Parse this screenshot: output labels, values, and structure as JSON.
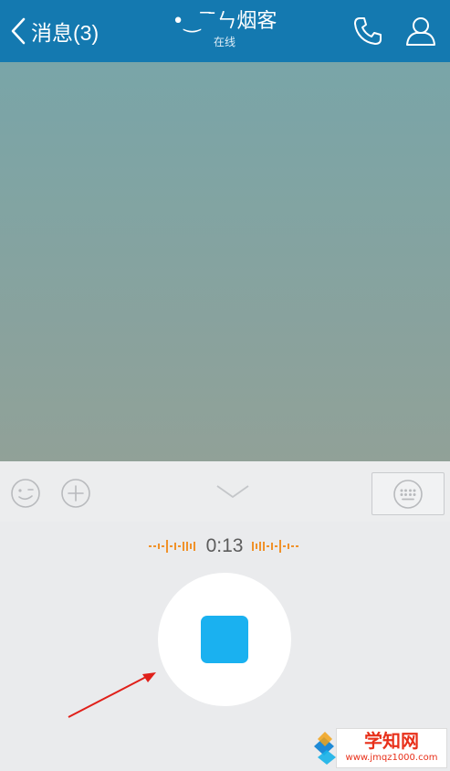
{
  "header": {
    "back_label": "消息(3)",
    "title": "•‿‾ ̄ㄣ烟客",
    "status": "在线"
  },
  "recorder": {
    "timer": "0:13",
    "state": "recording"
  },
  "watermark": {
    "title": "学知网",
    "url": "www.jmqz1000.com"
  },
  "colors": {
    "header_bg": "#1479b0",
    "stop_button": "#1ab1f0",
    "wave": "#f0922b",
    "arrow": "#e0201a"
  },
  "icons": [
    "back-chevron-icon",
    "phone-icon",
    "person-icon",
    "emoji-icon",
    "plus-icon",
    "chevron-down-icon",
    "keyboard-icon",
    "stop-icon"
  ]
}
